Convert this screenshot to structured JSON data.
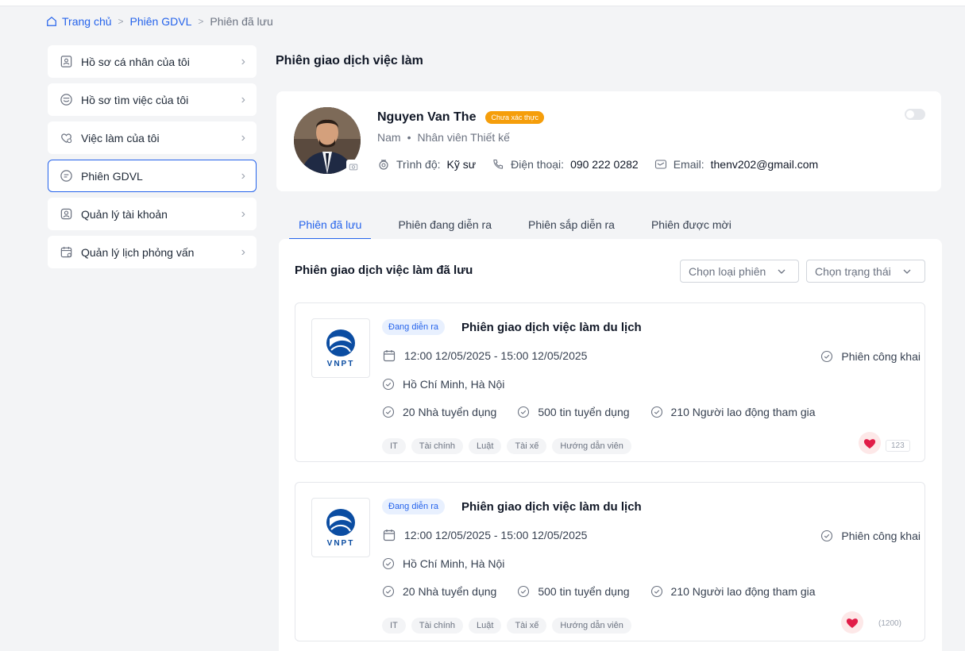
{
  "breadcrumb": {
    "home": "Trang chủ",
    "section": "Phiên GDVL",
    "current": "Phiên đã lưu",
    "separator": ">"
  },
  "sidebar": {
    "items": [
      {
        "label": "Hồ sơ cá nhân của tôi",
        "icon": "profile-badge-icon"
      },
      {
        "label": "Hồ sơ tìm việc của tôi",
        "icon": "job-profile-icon"
      },
      {
        "label": "Việc làm của tôi",
        "icon": "my-jobs-icon"
      },
      {
        "label": "Phiên GDVL",
        "icon": "session-icon"
      },
      {
        "label": "Quản lý tài khoản",
        "icon": "account-icon"
      },
      {
        "label": "Quản lý lịch phỏng vấn",
        "icon": "calendar-icon"
      }
    ],
    "active_index": 3
  },
  "page": {
    "title": "Phiên giao dịch việc làm"
  },
  "profile": {
    "name": "Nguyen Van The",
    "verify_badge": "Chưa xác thực",
    "gender": "Nam",
    "dot": "•",
    "position": "Nhân viên Thiết  kế",
    "education_label": "Trình độ:",
    "education_value": "Kỹ sư",
    "phone_label": "Điện thoại:",
    "phone_value": "090 222 0282",
    "email_label": "Email:",
    "email_value": "thenv202@gmail.com"
  },
  "tabs": [
    {
      "label": "Phiên đã lưu"
    },
    {
      "label": "Phiên đang diễn ra"
    },
    {
      "label": "Phiên sắp diễn ra"
    },
    {
      "label": "Phiên được mời"
    }
  ],
  "list": {
    "title": "Phiên giao dịch việc làm  đã lưu",
    "filter_type": "Chọn loại phiên",
    "filter_status": "Chọn trạng thái"
  },
  "cards": [
    {
      "logo_text": "VNPT",
      "status": "Đang diễn ra",
      "title": "Phiên giao dịch việc làm du lịch",
      "time": "12:00 12/05/2025 - 15:00  12/05/2025",
      "visibility": "Phiên công khai",
      "location": "Hồ Chí Minh, Hà Nội",
      "employers": "20 Nhà tuyển dụng",
      "postings": "500 tin tuyển dụng",
      "workers": "210 Người lao động tham gia",
      "tags": [
        "IT",
        "Tài chính",
        "Luật",
        "Tài xế",
        "Hướng dẫn viên"
      ],
      "likes": "123"
    },
    {
      "logo_text": "VNPT",
      "status": "Đang diễn ra",
      "title": "Phiên giao dịch việc làm du lịch",
      "time": "12:00 12/05/2025 - 15:00  12/05/2025",
      "visibility": "Phiên công khai",
      "location": "Hồ Chí Minh, Hà Nội",
      "employers": "20 Nhà tuyển dụng",
      "postings": "500 tin tuyển dụng",
      "workers": "210 Người lao động tham gia",
      "tags": [
        "IT",
        "Tài chính",
        "Luật",
        "Tài xế",
        "Hướng dẫn viên"
      ],
      "likes": "(1200)"
    }
  ],
  "colors": {
    "accent": "#2563eb",
    "warning": "#f59e0b",
    "heart": "#e11d48"
  }
}
